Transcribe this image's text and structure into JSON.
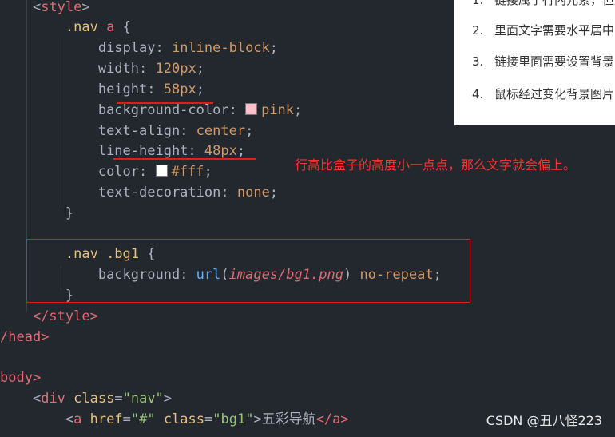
{
  "code": {
    "l0": {
      "open": "<",
      "name": "style",
      "close": ">"
    },
    "l1": {
      "selector": ".nav",
      "tag": "a",
      "brace": "{"
    },
    "l2": {
      "prop": "display",
      "value": "inline-block"
    },
    "l3": {
      "prop": "width",
      "value": "120px"
    },
    "l4": {
      "prop": "height",
      "value": "58px"
    },
    "l5": {
      "prop": "background-color",
      "value": "pink",
      "swatch_color": "#ffc0cb"
    },
    "l6": {
      "prop": "text-align",
      "value": "center"
    },
    "l7": {
      "prop": "line-height",
      "value": "48px"
    },
    "l8": {
      "prop": "color",
      "value": "#fff",
      "swatch_color": "#ffffff"
    },
    "l9": {
      "prop": "text-decoration",
      "value": "none"
    },
    "l10": {
      "brace": "}"
    },
    "l12": {
      "selector": ".nav .bg1",
      "brace": "{"
    },
    "l13": {
      "prop": "background",
      "fn": "url",
      "open_paren": "(",
      "path": "images/bg1.png",
      "close_paren": ")",
      "value": "no-repeat"
    },
    "l14": {
      "brace": "}"
    },
    "l15": {
      "text": "</style>"
    },
    "l16": {
      "text": "/head>"
    },
    "l18": {
      "text": "body>"
    },
    "l19": {
      "open": "<",
      "tag": "div",
      "attr": "class",
      "eq": "=",
      "val": "\"nav\"",
      "close": ">"
    },
    "l20": {
      "open": "<",
      "tag": "a",
      "attr1": "href",
      "eq1": "=",
      "val1": "\"#\"",
      "attr2": "class",
      "eq2": "=",
      "val2": "\"bg1\"",
      "gt": ">",
      "text": "五彩导航",
      "closetag": "</a>"
    }
  },
  "annotation": "行高比盒子的高度小一点点，那么文字就会偏上。",
  "panel": {
    "items": [
      {
        "num": "1.",
        "text": "链接属于行内元素，但"
      },
      {
        "num": "2.",
        "text": "里面文字需要水平居中"
      },
      {
        "num": "3.",
        "text": "链接里面需要设置背景"
      },
      {
        "num": "4.",
        "text": "鼠标经过变化背景图片"
      }
    ]
  },
  "watermark": "CSDN @丑八怪223",
  "colors": {
    "background": "#23272e",
    "annotation": "#ff3030",
    "underline": "#e21b1b"
  }
}
